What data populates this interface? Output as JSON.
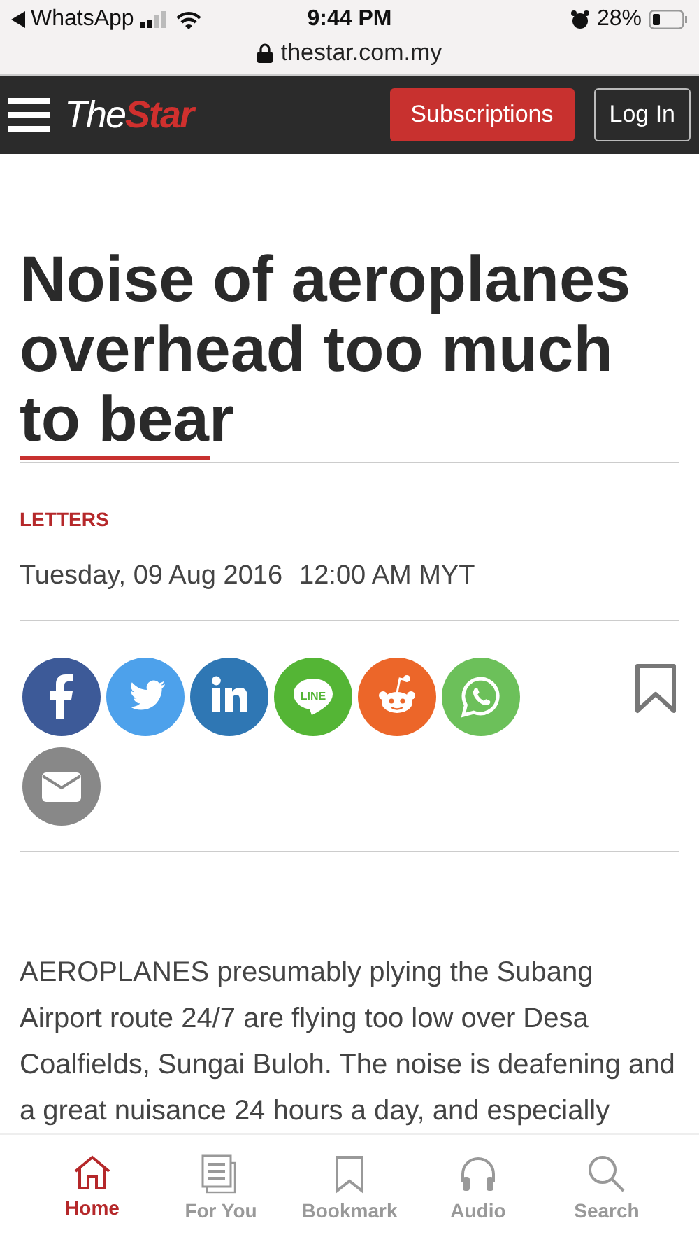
{
  "status_bar": {
    "back_app": "WhatsApp",
    "time": "9:44 PM",
    "battery": "28%",
    "url": "thestar.com.my"
  },
  "header": {
    "logo": {
      "first": "The",
      "second": "Star"
    },
    "buttons": [
      {
        "label": "Subscriptions",
        "kind": "primary"
      },
      {
        "label": "Log In",
        "kind": "outline"
      }
    ]
  },
  "article": {
    "title": "Noise of aeroplanes overhead too much to bear",
    "category": "LETTERS",
    "date": "Tuesday, 09 Aug 2016",
    "time": "12:00 AM MYT",
    "share": [
      {
        "kind": "facebook",
        "color": "#3d5a98"
      },
      {
        "kind": "twitter",
        "color": "#4da1eb"
      },
      {
        "kind": "linkedin",
        "color": "#2f77b4"
      },
      {
        "kind": "line",
        "color": "#54b535",
        "text": "LINE"
      },
      {
        "kind": "reddit",
        "color": "#ec6629"
      },
      {
        "kind": "whatsapp",
        "color": "#6cc05a"
      },
      {
        "kind": "email",
        "color": "#888888"
      }
    ],
    "body": "AEROPLANES presumably plying the Subang Airport route 24/7 are flying too low over Desa Coalfields, Sungai Buloh. The noise is deafening and a great nuisance 24 hours a day, and especially"
  },
  "bottom_nav": [
    {
      "label": "Home",
      "kind": "home",
      "selected": true
    },
    {
      "label": "For You",
      "kind": "foryou",
      "selected": false
    },
    {
      "label": "Bookmark",
      "kind": "bookmark",
      "selected": false
    },
    {
      "label": "Audio",
      "kind": "audio",
      "selected": false
    },
    {
      "label": "Search",
      "kind": "search",
      "selected": false
    }
  ]
}
